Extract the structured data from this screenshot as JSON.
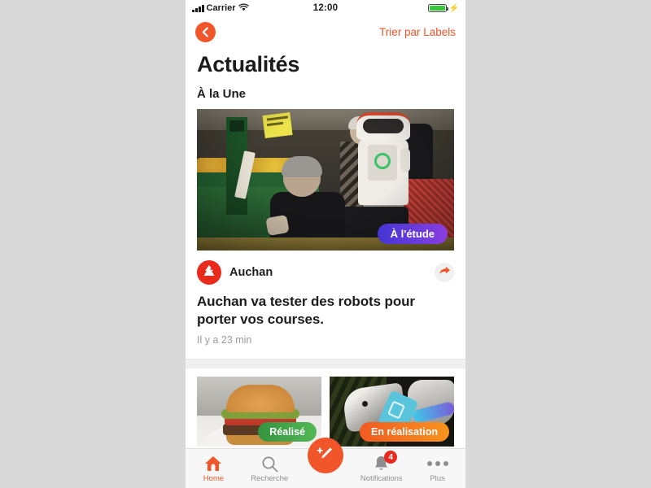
{
  "status_bar": {
    "carrier": "Carrier",
    "time": "12:00",
    "signal_icon": "signal-bars-icon",
    "wifi_icon": "wifi-icon",
    "battery_icon": "battery-full-icon",
    "charging_icon": "charging-bolt-icon"
  },
  "nav": {
    "back_icon": "chevron-left-icon",
    "sort_label": "Trier par Labels"
  },
  "header": {
    "page_title": "Actualités",
    "section_title": "À la Une"
  },
  "featured": {
    "image_alt": "supermarket-robot-photo",
    "badge": "À l'étude",
    "badge_color": "#6a3ada",
    "source_name": "Auchan",
    "source_logo": "auchan-logo-icon",
    "share_icon": "share-arrow-icon",
    "headline": "Auchan va tester des robots pour porter vos courses.",
    "timestamp": "Il y a 23 min"
  },
  "cards": [
    {
      "image_alt": "burger-photo",
      "badge": "Réalisé",
      "badge_color": "#44a94b"
    },
    {
      "image_alt": "robot-hand-smartphone-photo",
      "badge": "En réalisation",
      "badge_color": "#f5701f"
    }
  ],
  "tabbar": {
    "items": [
      {
        "label": "Home",
        "icon": "home-icon",
        "active": true
      },
      {
        "label": "Recherche",
        "icon": "search-icon",
        "active": false
      },
      {
        "label": "Notifications",
        "icon": "bell-icon",
        "active": false,
        "badge": "4"
      },
      {
        "label": "Plus",
        "icon": "more-dots-icon",
        "active": false
      }
    ],
    "compose_icon": "pencil-plus-icon",
    "accent_color": "#f0562a"
  }
}
